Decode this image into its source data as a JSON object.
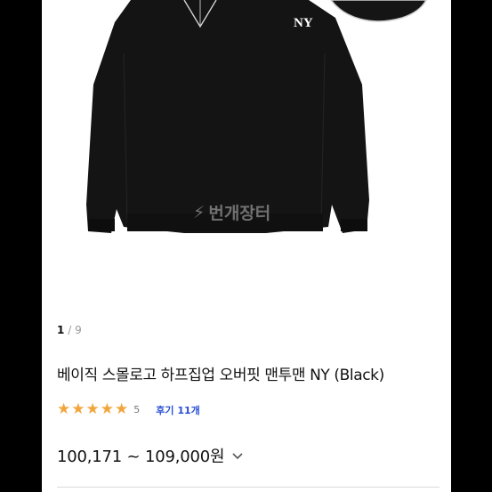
{
  "watermark": {
    "text": "번개장터"
  },
  "image_pager": {
    "current": "1",
    "separator": "/",
    "total": "9"
  },
  "product": {
    "title": "베이직 스몰로고 하프집업 오버핏 맨투맨 NY (Black)",
    "rating_value": "5",
    "stars": 5,
    "review_label": "후기 11개",
    "price_range": "100,171 ~ 109,000원"
  },
  "colors": {
    "star": "#f2a53c",
    "review_link": "#2a4fd6",
    "garment": "#141414"
  },
  "icons": {
    "watermark": "lightning-bolt-icon",
    "price_toggle": "chevron-down-icon",
    "star": "star-icon"
  }
}
